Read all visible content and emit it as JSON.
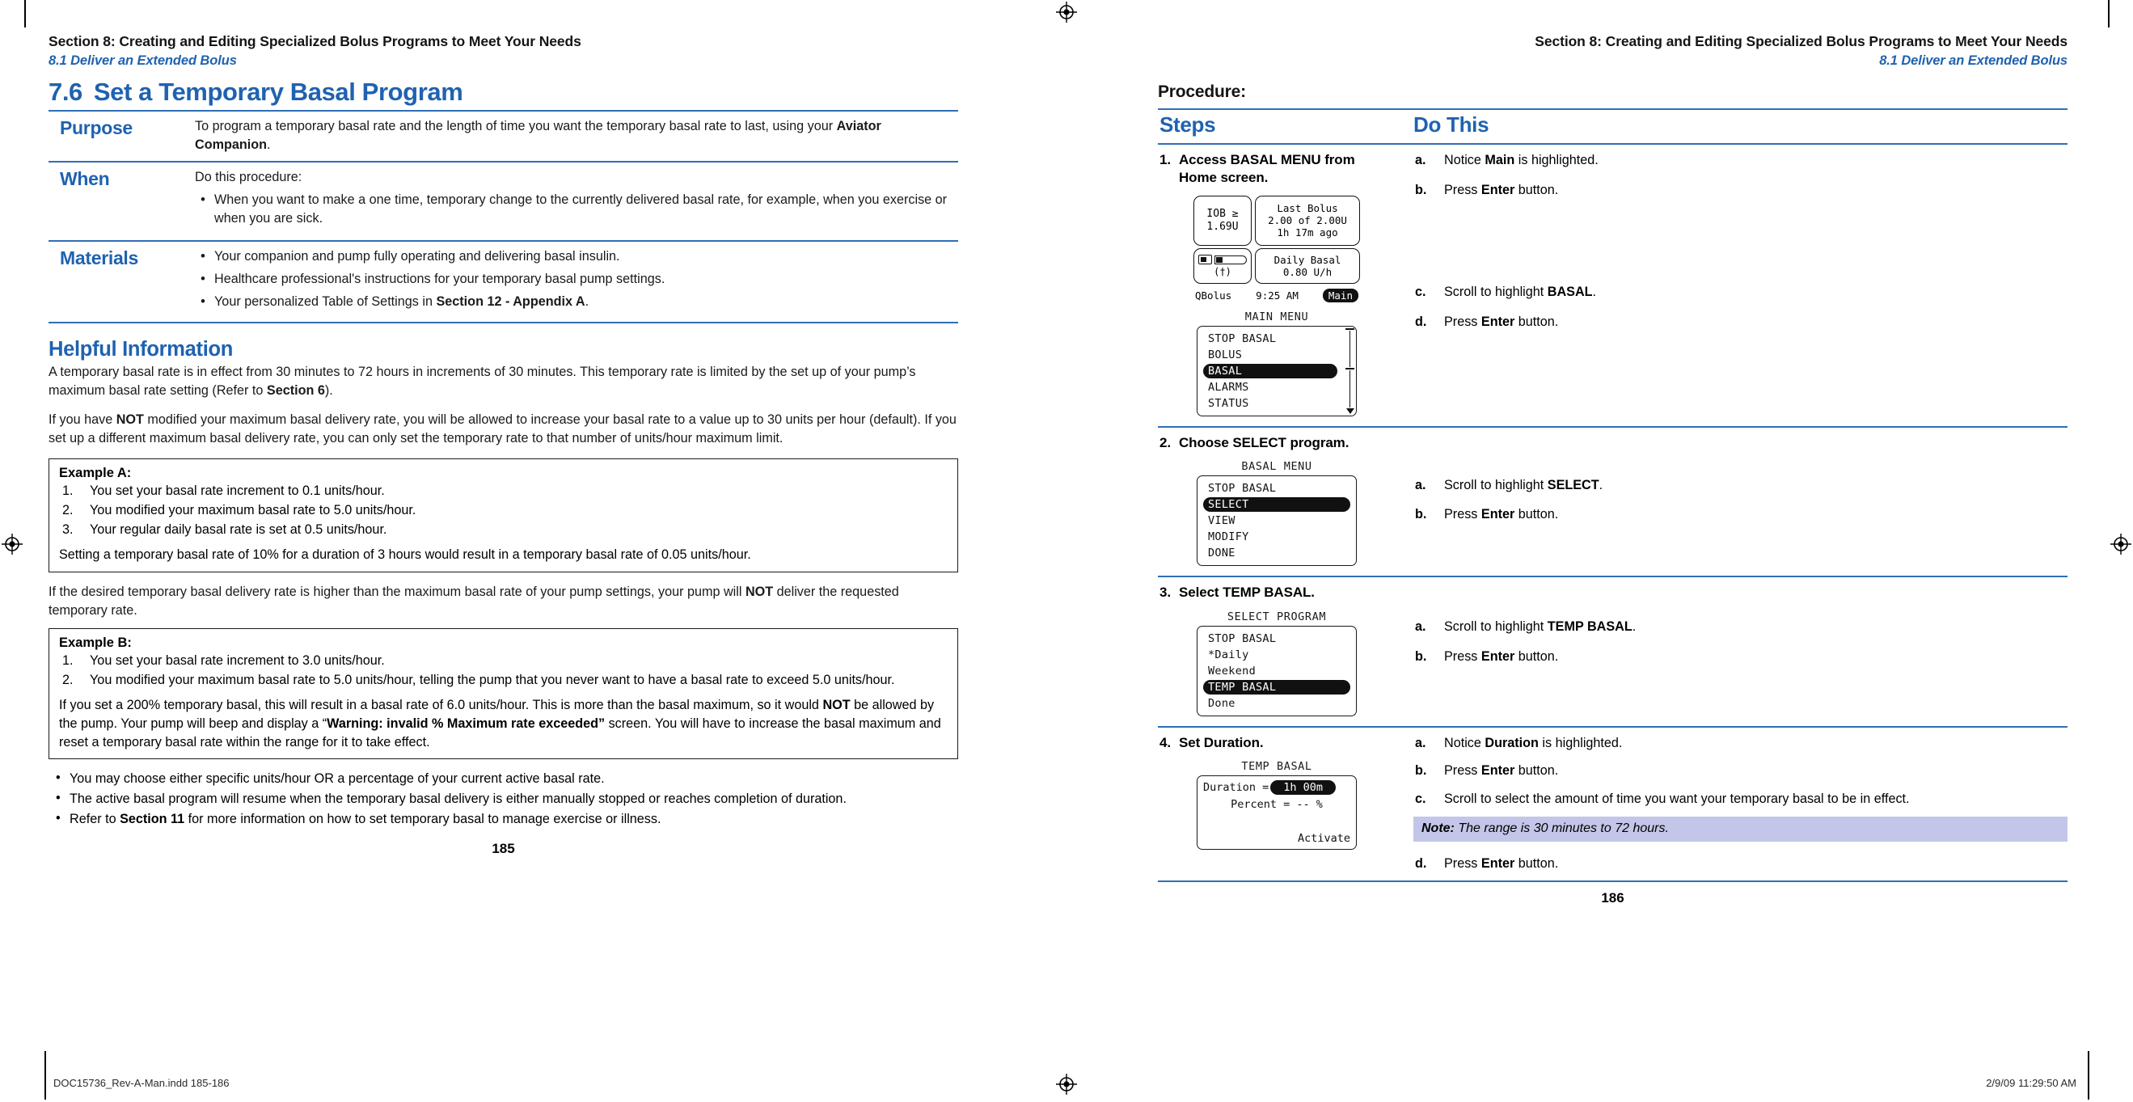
{
  "document": {
    "imprint_left": "DOC15736_Rev-A-Man.indd   185-186",
    "imprint_right": "2/9/09   11:29:50 AM"
  },
  "left_page": {
    "running_head": "Section 8: Creating and Editing Specialized Bolus Programs to Meet Your Needs",
    "running_subhead": "8.1 Deliver an Extended Bolus",
    "section_number": "7.6",
    "section_title": "Set a Temporary Basal Program",
    "folio": "185",
    "info_table": [
      {
        "label": "Purpose",
        "intro": "To program a temporary basal rate and the length of time you want the temporary basal rate to last, using your ",
        "intro_bold": "Aviator Companion",
        "intro_tail": ".",
        "bullets": []
      },
      {
        "label": "When",
        "intro": "Do this procedure:",
        "bullets": [
          "When you want to make a one time, temporary change to the currently delivered basal rate, for example, when you exercise or when you are sick."
        ]
      },
      {
        "label": "Materials",
        "intro": "",
        "bullets": [
          "Your companion and pump fully operating and delivering basal insulin.",
          "Healthcare professional's instructions for your temporary basal pump settings.",
          "Your personalized Table of Settings in Section 12 - Appendix A."
        ],
        "bullets_bold_tail": [
          "",
          "",
          "Section 12 - Appendix A"
        ]
      }
    ],
    "helpful_heading": "Helpful Information",
    "helpful_para1": "A temporary basal rate is in effect from 30 minutes to 72 hours in increments of 30 minutes. This temporary rate is limited by the set up of your pump's maximum basal rate setting (Refer to Section 6).",
    "helpful_para1_bold": "Section 6",
    "helpful_para2_a": "If you have ",
    "helpful_para2_bold": "NOT",
    "helpful_para2_b": " modified your maximum basal delivery rate, you will be allowed to increase your basal rate to a value up to 30 units per hour (default). If you set up a different maximum basal delivery rate, you can only set the temporary rate to that number of units/hour maximum limit.",
    "example_a": {
      "title": "Example A:",
      "items": [
        "You set your basal rate increment to 0.1 units/hour.",
        "You modified your maximum basal rate to 5.0 units/hour.",
        "Your regular daily basal rate is set at 0.5 units/hour."
      ],
      "conclusion": "Setting a temporary basal rate of 10% for a duration of 3 hours would result in a temporary basal rate of 0.05 units/hour."
    },
    "between_para_a": "If the desired temporary basal delivery rate is higher than the maximum basal rate of your pump settings, your pump will ",
    "between_para_bold": "NOT",
    "between_para_b": " deliver the requested temporary rate.",
    "example_b": {
      "title": "Example B:",
      "items": [
        "You set your basal rate increment to 3.0 units/hour.",
        "You modified your maximum basal rate to 5.0 units/hour, telling the pump that you never want to have a basal rate to exceed 5.0 units/hour."
      ],
      "conclusion_1": "If you set a 200% temporary basal, this will result in a basal rate of 6.0 units/hour. This is more than the basal maximum, so it would ",
      "conclusion_bold_1": "NOT",
      "conclusion_2": " be allowed by the pump. Your pump will beep and display a “",
      "conclusion_bold_2": "Warning: invalid % Maximum rate exceeded”",
      "conclusion_3": " screen. You will have to increase the basal maximum and reset a temporary basal rate within the range for it to take effect."
    },
    "closing_bullets": [
      {
        "text": "You may choose either specific units/hour OR a percentage of your current active basal rate."
      },
      {
        "text": "The active basal program will resume when the temporary basal delivery is either manually stopped or reaches completion of duration."
      },
      {
        "pre": "Refer to ",
        "bold": "Section 11",
        "post": " for more information on how to set temporary basal to manage exercise or illness."
      }
    ]
  },
  "right_page": {
    "running_head": "Section 8: Creating and Editing Specialized Bolus Programs to Meet Your Needs",
    "running_subhead": "8.1 Deliver an Extended Bolus",
    "procedure_label": "Procedure:",
    "col_headers": {
      "steps": "Steps",
      "do_this": "Do This"
    },
    "folio": "186",
    "steps": [
      {
        "num": "1.",
        "title": "Access BASAL MENU from Home screen.",
        "screens": [
          {
            "type": "home",
            "iob_label": "IOB ≥",
            "iob_value": "1.69U",
            "last_bolus_label": "Last Bolus",
            "last_bolus_value": "2.00 of 2.00U",
            "last_bolus_ago": "1h 17m ago",
            "daily_basal_label": "Daily Basal",
            "daily_basal_value": "0.80 U/h",
            "foot_left": "QBolus",
            "foot_time": "9:25 AM",
            "foot_right": "Main"
          },
          {
            "type": "menu",
            "title": "MAIN MENU",
            "items": [
              "STOP BASAL",
              "BOLUS",
              "BASAL",
              "ALARMS",
              "STATUS"
            ],
            "highlight": "BASAL",
            "scrollbar": true
          }
        ],
        "actions": [
          {
            "mark": "a.",
            "pre": "Notice ",
            "bold": "Main",
            "post": " is highlighted."
          },
          {
            "mark": "b.",
            "pre": "Press ",
            "bold": "Enter",
            "post": " button.",
            "gap": true
          },
          {
            "mark": "c.",
            "pre": "Scroll to highlight ",
            "bold": "BASAL",
            "post": "."
          },
          {
            "mark": "d.",
            "pre": "Press ",
            "bold": "Enter",
            "post": " button."
          }
        ]
      },
      {
        "num": "2.",
        "title": "Choose SELECT program.",
        "screens": [
          {
            "type": "menu",
            "title": "BASAL MENU",
            "items": [
              "STOP BASAL",
              "SELECT",
              "VIEW",
              "MODIFY",
              "DONE"
            ],
            "highlight": "SELECT",
            "scrollbar": false
          }
        ],
        "actions": [
          {
            "mark": "a.",
            "pre": "Scroll to highlight ",
            "bold": "SELECT",
            "post": "."
          },
          {
            "mark": "b.",
            "pre": "Press ",
            "bold": "Enter",
            "post": " button."
          }
        ]
      },
      {
        "num": "3.",
        "title": "Select TEMP BASAL.",
        "screens": [
          {
            "type": "menu",
            "title": "SELECT PROGRAM",
            "items": [
              "STOP BASAL",
              "*Daily",
              "Weekend",
              "TEMP BASAL",
              "Done"
            ],
            "highlight": "TEMP BASAL",
            "scrollbar": false
          }
        ],
        "actions": [
          {
            "mark": "a.",
            "pre": "Scroll to highlight ",
            "bold": "TEMP BASAL",
            "post": "."
          },
          {
            "mark": "b.",
            "pre": "Press ",
            "bold": "Enter",
            "post": " button."
          }
        ]
      },
      {
        "num": "4.",
        "title": "Set Duration.",
        "screens": [
          {
            "type": "temp",
            "title": "TEMP BASAL",
            "duration_label": "Duration =",
            "duration_value": "1h 00m",
            "percent_line": "Percent = -- %",
            "activate": "Activate"
          }
        ],
        "actions": [
          {
            "mark": "a.",
            "pre": "Notice ",
            "bold": "Duration",
            "post": " is highlighted."
          },
          {
            "mark": "b.",
            "pre": "Press ",
            "bold": "Enter",
            "post": " button."
          },
          {
            "mark": "c.",
            "pre": "Scroll to select the amount of time you want your temporary basal to be in effect.",
            "bold": "",
            "post": ""
          }
        ],
        "note": {
          "label": "Note:",
          "text": " The range is 30 minutes to 72 hours."
        },
        "actions_after_note": [
          {
            "mark": "d.",
            "pre": "Press ",
            "bold": "Enter",
            "post": " button."
          }
        ]
      }
    ]
  }
}
